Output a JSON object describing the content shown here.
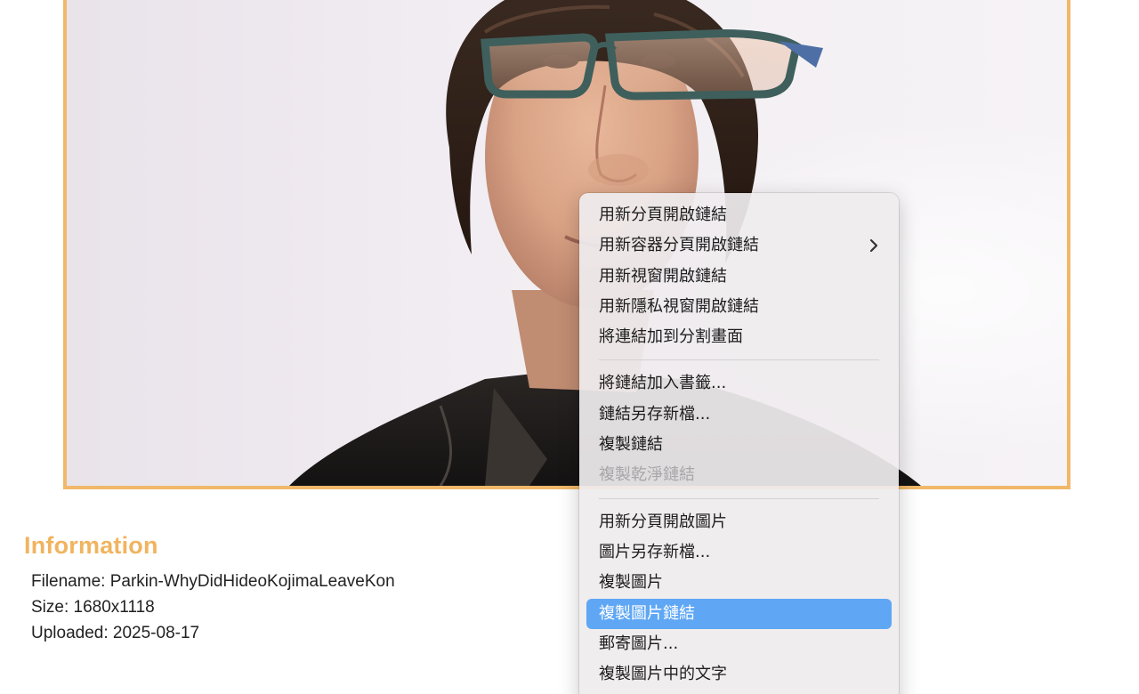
{
  "info": {
    "heading": "Information",
    "filename_label": "Filename: Parkin-WhyDidHideoKojimaLeaveKon",
    "size_label": "Size: 1680x1118",
    "uploaded_label": "Uploaded: 2025-08-17"
  },
  "colors": {
    "frame_border": "#f0b869",
    "heading": "#f0b45f",
    "menu_highlight": "#5fa7f4"
  },
  "context_menu": {
    "group1": [
      {
        "label": "用新分頁開啟鏈結"
      },
      {
        "label": "用新容器分頁開啟鏈結",
        "submenu_icon": "chevron-right-icon"
      },
      {
        "label": "用新視窗開啟鏈結"
      },
      {
        "label": "用新隱私視窗開啟鏈結"
      },
      {
        "label": "將連結加到分割畫面"
      }
    ],
    "group2": [
      {
        "label": "將鏈結加入書籤..."
      },
      {
        "label": "鏈結另存新檔..."
      },
      {
        "label": "複製鏈結"
      },
      {
        "label": "複製乾淨鏈結",
        "disabled": true
      }
    ],
    "group3": [
      {
        "label": "用新分頁開啟圖片"
      },
      {
        "label": "圖片另存新檔..."
      },
      {
        "label": "複製圖片"
      },
      {
        "label": "複製圖片鏈結",
        "highlighted": true
      },
      {
        "label": "郵寄圖片..."
      },
      {
        "label": "複製圖片中的文字"
      }
    ]
  }
}
